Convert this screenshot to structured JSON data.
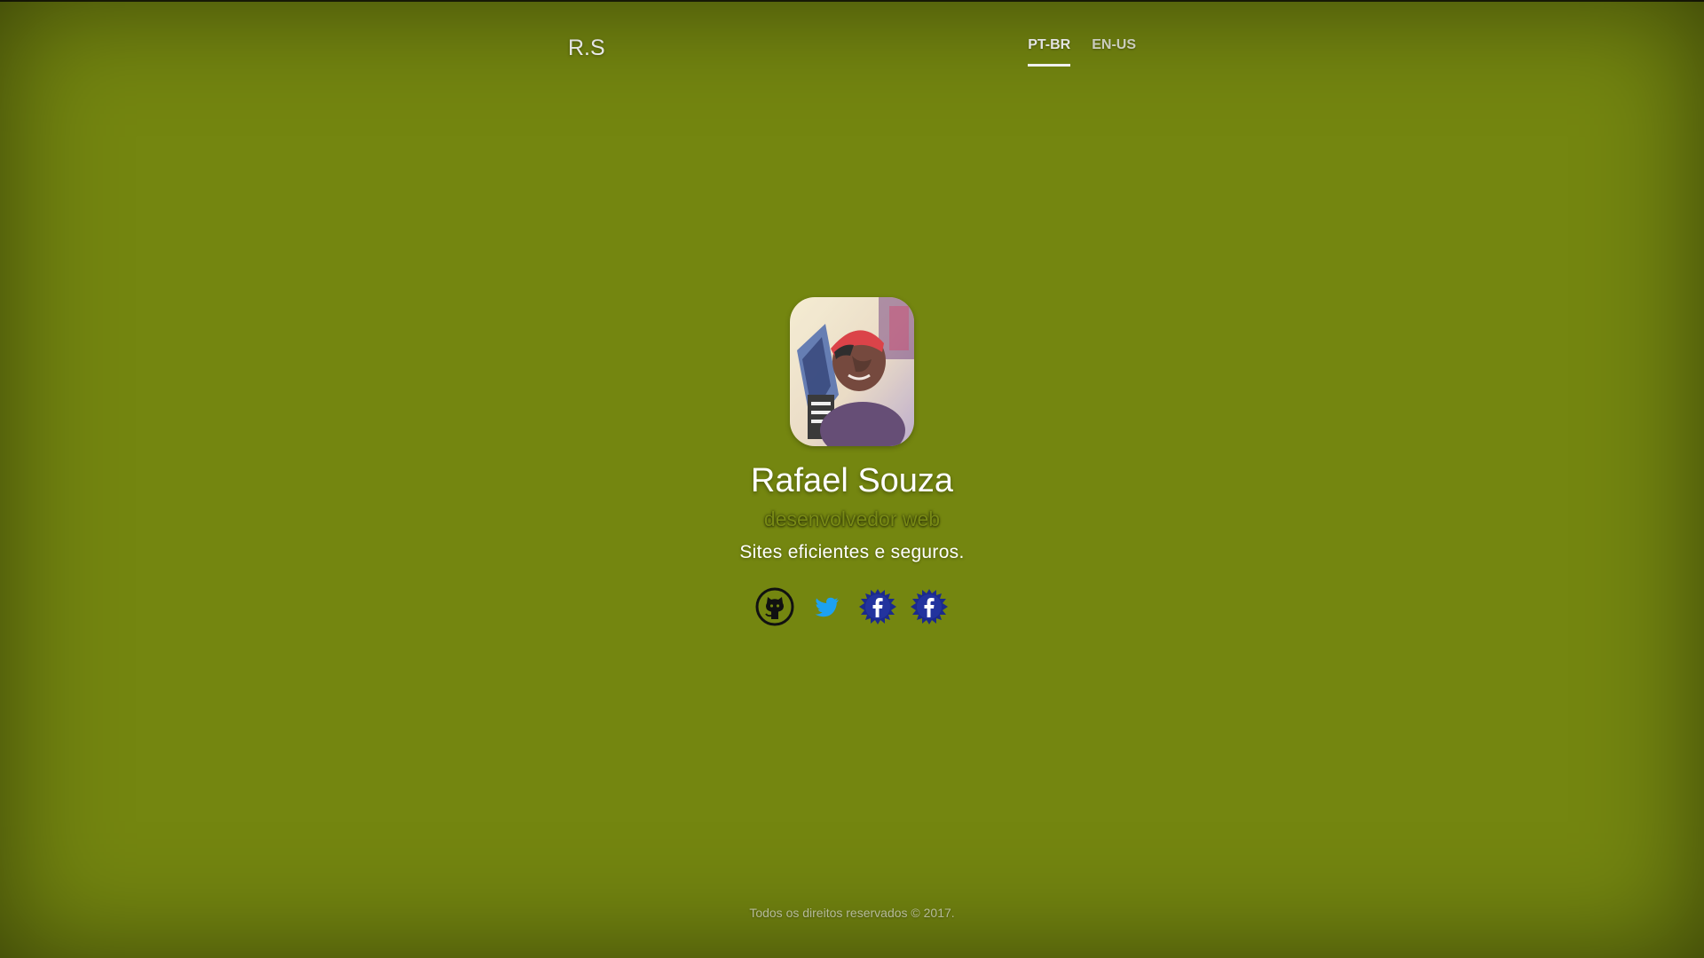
{
  "header": {
    "brand": "R.S",
    "languages": [
      {
        "label": "PT-BR",
        "active": true
      },
      {
        "label": "EN-US",
        "active": false
      }
    ]
  },
  "profile": {
    "name": "Rafael Souza",
    "role": "desenvolvedor web",
    "tagline": "Sites eficientes e seguros."
  },
  "social": [
    {
      "icon": "github-icon"
    },
    {
      "icon": "twitter-icon"
    },
    {
      "icon": "facebook-icon"
    },
    {
      "icon": "facebook-icon"
    }
  ],
  "footer": {
    "copyright": "Todos os direitos reservados © 2017."
  },
  "colors": {
    "background": "#748610",
    "text": "#ffffff",
    "twitter": "#1da1f2",
    "facebook": "#1b2a8c"
  }
}
